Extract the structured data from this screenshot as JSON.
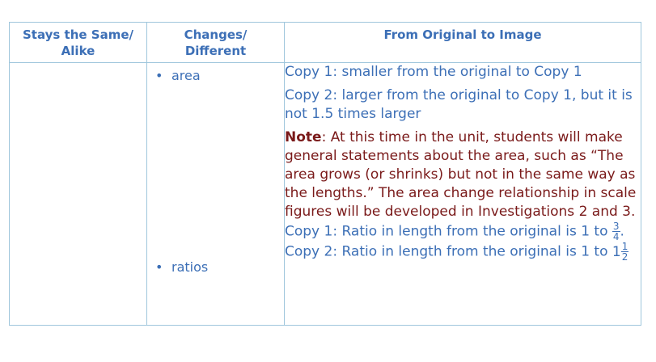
{
  "headers": {
    "col1_line1": "Stays the Same/",
    "col1_line2": "Alike",
    "col2_line1": "Changes/",
    "col2_line2": "Different",
    "col3": "From Original to Image"
  },
  "rows": {
    "bullet_glyph": "•",
    "changes_area": "area",
    "changes_ratios": "ratios",
    "copy1_area": "Copy 1: smaller from the original to Copy 1",
    "copy2_area": "Copy 2: larger from the original to Copy 1, but it is not 1.5 times larger",
    "note_label": "Note",
    "note_text": ": At this time in the unit, students will make general statements about the area, such as “The area grows (or shrinks) but not in the same way as the lengths.” The area change relationship in scale figures will be developed in Investigations 2 and 3.",
    "copy1_ratio_prefix": "Copy 1: Ratio in length from the original is 1 to",
    "copy1_ratio_num": "3",
    "copy1_ratio_den": "4",
    "copy1_ratio_end": ".",
    "copy2_ratio_prefix": "Copy 2: Ratio in length from the original is 1 to",
    "copy2_ratio_whole": "1",
    "copy2_ratio_num": "1",
    "copy2_ratio_den": "2"
  },
  "colors": {
    "text_blue": "#3c6fb6",
    "note_red": "#7a1a1a",
    "border": "#9fc6dc"
  }
}
